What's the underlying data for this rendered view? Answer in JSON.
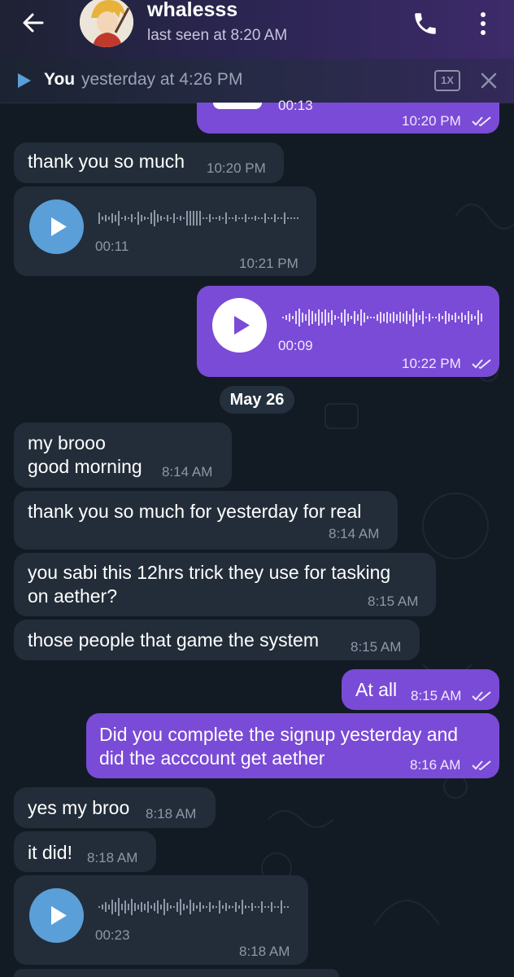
{
  "header": {
    "contact_name": "whalesss",
    "last_seen": "last seen at 8:20 AM",
    "icons": {
      "back": "back-arrow-icon",
      "call": "phone-icon",
      "menu": "more-vertical-icon"
    }
  },
  "pinned_audio": {
    "author": "You",
    "when": "yesterday at 4:26 PM",
    "speed": "1X"
  },
  "colors": {
    "incoming_bubble": "#222d39",
    "outgoing_bubble": "#7a4bd6",
    "play_button": "#5a9fd8",
    "background": "#121b24"
  },
  "messages": {
    "m0": {
      "time": "10:20 PM",
      "duration": "00:13"
    },
    "m1": {
      "text": "thank you so much",
      "time": "10:20 PM"
    },
    "m2": {
      "duration": "00:11",
      "time": "10:21 PM"
    },
    "m3": {
      "duration": "00:09",
      "time": "10:22 PM"
    },
    "date": "May 26",
    "m4": {
      "line1": "my brooo",
      "line2": "good morning",
      "time": "8:14 AM"
    },
    "m5": {
      "text": "thank you so much for yesterday for real",
      "time": "8:14 AM"
    },
    "m6": {
      "line1": "you sabi this 12hrs trick they use for tasking",
      "line2": "on aether?",
      "time": "8:15 AM"
    },
    "m7": {
      "text": "those people that game the system",
      "time": "8:15 AM"
    },
    "m8": {
      "text": "At all",
      "time": "8:15 AM"
    },
    "m9": {
      "line1": "Did you complete the signup yesterday and",
      "line2": "did the acccount get aether",
      "time": "8:16 AM"
    },
    "m10": {
      "text": "yes my broo",
      "time": "8:18 AM"
    },
    "m11": {
      "text": "it did!",
      "time": "8:18 AM"
    },
    "m12": {
      "duration": "00:23",
      "time": "8:18 AM"
    }
  }
}
